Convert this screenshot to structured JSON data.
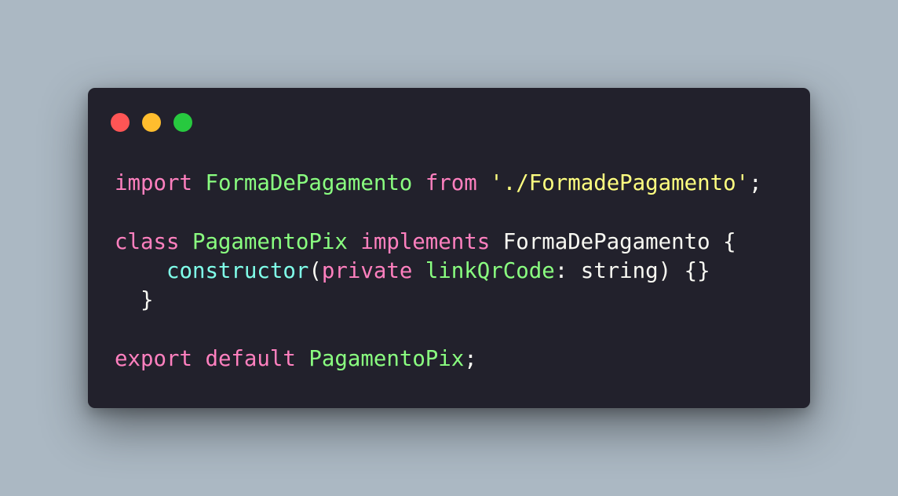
{
  "window": {
    "controls": [
      {
        "name": "close",
        "color": "#ff5555"
      },
      {
        "name": "minimize",
        "color": "#ffbd2e"
      },
      {
        "name": "maximize",
        "color": "#27c93f"
      }
    ]
  },
  "colors": {
    "keyword": "#ff80bf",
    "identifier": "#8aff80",
    "string": "#ffff80",
    "function": "#80ffea",
    "plain": "#f8f8f2"
  },
  "code_lines": [
    [
      {
        "text": "import",
        "type": "keyword"
      },
      {
        "text": " ",
        "type": "plain"
      },
      {
        "text": "FormaDePagamento",
        "type": "identifier"
      },
      {
        "text": " ",
        "type": "plain"
      },
      {
        "text": "from",
        "type": "keyword"
      },
      {
        "text": " ",
        "type": "plain"
      },
      {
        "text": "'./FormadePagamento'",
        "type": "string"
      },
      {
        "text": ";",
        "type": "plain"
      }
    ],
    [],
    [
      {
        "text": "class",
        "type": "keyword"
      },
      {
        "text": " ",
        "type": "plain"
      },
      {
        "text": "PagamentoPix",
        "type": "identifier"
      },
      {
        "text": " ",
        "type": "plain"
      },
      {
        "text": "implements",
        "type": "keyword"
      },
      {
        "text": " FormaDePagamento {",
        "type": "plain"
      }
    ],
    [
      {
        "text": "    ",
        "type": "plain"
      },
      {
        "text": "constructor",
        "type": "function"
      },
      {
        "text": "(",
        "type": "plain"
      },
      {
        "text": "private",
        "type": "keyword"
      },
      {
        "text": " ",
        "type": "plain"
      },
      {
        "text": "linkQrCode",
        "type": "identifier"
      },
      {
        "text": ": string) {}",
        "type": "plain"
      }
    ],
    [
      {
        "text": "  }",
        "type": "plain"
      }
    ],
    [],
    [
      {
        "text": "export",
        "type": "keyword"
      },
      {
        "text": " ",
        "type": "plain"
      },
      {
        "text": "default",
        "type": "keyword"
      },
      {
        "text": " ",
        "type": "plain"
      },
      {
        "text": "PagamentoPix",
        "type": "identifier"
      },
      {
        "text": ";",
        "type": "plain"
      }
    ]
  ]
}
